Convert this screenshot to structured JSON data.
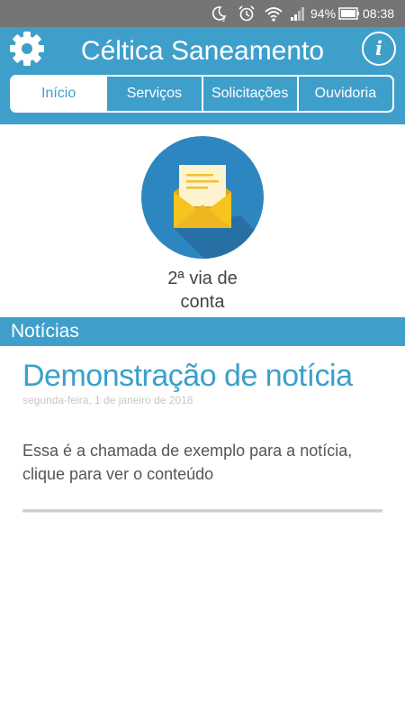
{
  "status_bar": {
    "battery_percent": "94%",
    "time": "08:38",
    "icons": [
      "moon-icon",
      "alarm-icon",
      "wifi-icon",
      "signal-icon",
      "battery-icon"
    ]
  },
  "app": {
    "title": "Céltica Saneamento",
    "settings_icon": "gear-icon",
    "info_icon": "info-icon",
    "info_glyph": "i",
    "tabs": [
      {
        "label": "Início",
        "selected": true
      },
      {
        "label": "Serviços",
        "selected": false
      },
      {
        "label": "Solicitações",
        "selected": false
      },
      {
        "label": "Ouvidoria",
        "selected": false
      }
    ]
  },
  "hero": {
    "icon": "envelope-letter-icon",
    "label_line1": "2ª via de",
    "label_line2": "conta"
  },
  "news": {
    "section_title": "Notícias",
    "items": [
      {
        "title": "Demonstração de notícia",
        "date": "segunda-feira, 1 de janeiro de 2018",
        "summary": "Essa é a chamada de exemplo para a notícia, clique para ver o conteúdo"
      }
    ]
  },
  "colors": {
    "brand": "#3f9fcb",
    "status_bar": "#757575",
    "envelope": "#f2c12e",
    "circle": "#2e86c1"
  }
}
